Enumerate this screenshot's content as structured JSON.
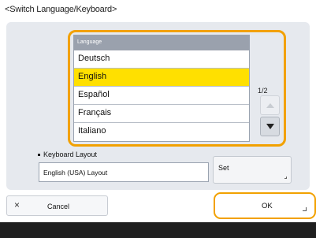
{
  "screen": {
    "title": "<Switch Language/Keyboard>"
  },
  "language_list": {
    "header": "Language",
    "items": [
      "Deutsch",
      "English",
      "Español",
      "Français",
      "Italiano"
    ],
    "selected": "English"
  },
  "pagination": {
    "indicator": "1/2"
  },
  "keyboard_layout": {
    "label": "Keyboard Layout",
    "value": "English (USA) Layout",
    "set_label": "Set"
  },
  "footer": {
    "cancel_label": "Cancel",
    "ok_label": "OK"
  },
  "icons": {
    "cancel": "close-icon",
    "scroll_up": "triangle-up-icon",
    "scroll_down": "triangle-down-icon"
  },
  "colors": {
    "selection": "#ffe000",
    "focus_outline": "#f2a100",
    "panel": "#e6e9ee",
    "header": "#9aa1ad"
  }
}
